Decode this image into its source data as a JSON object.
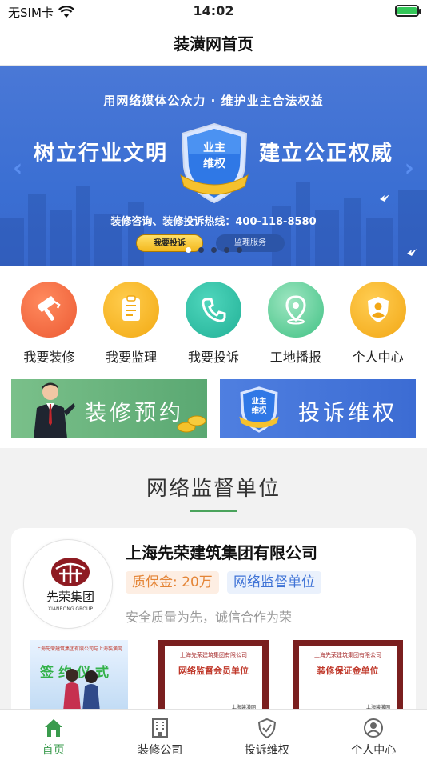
{
  "status_bar": {
    "carrier": "无SIM卡",
    "time": "14:02"
  },
  "nav": {
    "title": "装潢网首页"
  },
  "banner": {
    "slogan": "用网络媒体公众力 · 维护业主合法权益",
    "left_text": "树立行业文明",
    "right_text": "建立公正权威",
    "shield_text_line1": "业主",
    "shield_text_line2": "维权",
    "hotline": "装修咨询、装修投诉热线：400-118-8580",
    "button_complain": "我要投诉",
    "button_supervise": "监理服务",
    "page_count": 5,
    "active_page": 1
  },
  "menu": {
    "items": [
      {
        "label": "我要装修",
        "icon": "paint-roller-icon",
        "color": "#f0643c"
      },
      {
        "label": "我要监理",
        "icon": "clipboard-icon",
        "color": "#f5b321"
      },
      {
        "label": "我要投诉",
        "icon": "phone-icon",
        "color": "#2fbea3"
      },
      {
        "label": "工地播报",
        "icon": "location-pin-icon",
        "color": "#4cc58b"
      },
      {
        "label": "个人中心",
        "icon": "user-shield-icon",
        "color": "#f4b525"
      }
    ]
  },
  "promos": {
    "left_title": "装修预约",
    "right_title": "投诉维权",
    "right_shield_line1": "业主",
    "right_shield_line2": "维权"
  },
  "section": {
    "title": "网络监督单位"
  },
  "company": {
    "name": "上海先荣建筑集团有限公司",
    "deposit": "质保金: 20万",
    "badge": "网络监督单位",
    "motto": "安全质量为先，诚信合作为荣",
    "logo_cn": "先荣集团",
    "logo_en": "XIANRONG GROUP",
    "photo1_title": "签约仪式",
    "photo1_caption": "上海先荣建筑集团有限公司与上海装潢网",
    "cert1_company": "上海先荣建筑集团有限公司",
    "cert1_title": "网络监督会员单位",
    "cert2_company": "上海先荣建筑集团有限公司",
    "cert2_title": "装修保证金单位",
    "cert_issuer": "上海装潢网"
  },
  "tabbar": {
    "items": [
      {
        "label": "首页",
        "icon": "home-icon",
        "active": true
      },
      {
        "label": "装修公司",
        "icon": "building-icon",
        "active": false
      },
      {
        "label": "投诉维权",
        "icon": "shield-check-icon",
        "active": false
      },
      {
        "label": "个人中心",
        "icon": "user-icon",
        "active": false
      }
    ]
  },
  "colors": {
    "accent": "#3a9b4d",
    "banner_blue": "#3b6fd3"
  }
}
